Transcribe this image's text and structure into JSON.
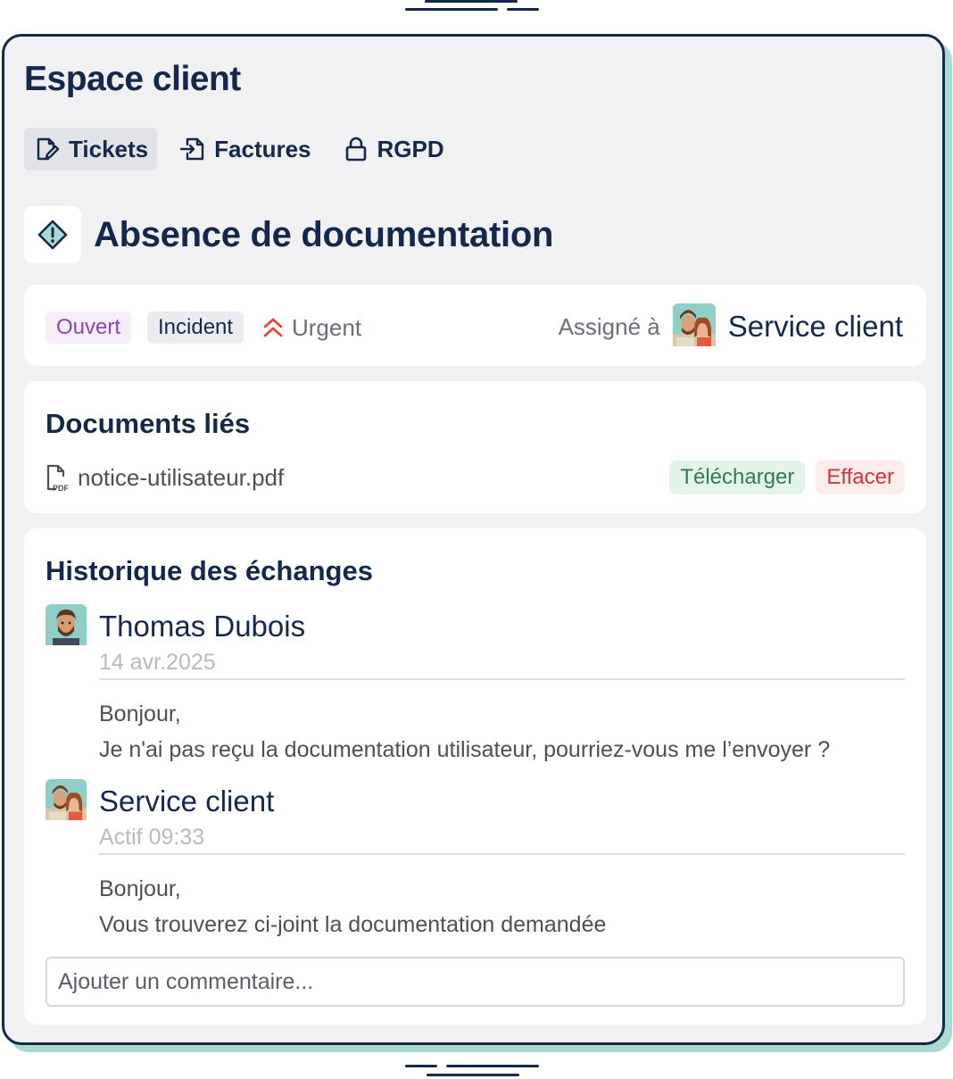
{
  "app": {
    "title": "Espace client"
  },
  "tabs": [
    {
      "label": "Tickets",
      "icon": "edit-document-icon",
      "active": true
    },
    {
      "label": "Factures",
      "icon": "file-import-icon",
      "active": false
    },
    {
      "label": "RGPD",
      "icon": "lock-icon",
      "active": false
    }
  ],
  "ticket": {
    "title": "Absence de documentation",
    "icon": "diamond-warning-icon",
    "status": "Ouvert",
    "type": "Incident",
    "priority": "Urgent",
    "assigned_label": "Assigné à",
    "assignee": "Service client"
  },
  "documents": {
    "heading": "Documents liés",
    "files": [
      {
        "name": "notice-utilisateur.pdf",
        "icon": "pdf-file-icon",
        "download_label": "Télécharger",
        "delete_label": "Effacer"
      }
    ]
  },
  "history": {
    "heading": "Historique des échanges",
    "messages": [
      {
        "author": "Thomas Dubois",
        "date": "14 avr.2025",
        "lines": [
          "Bonjour,",
          "Je n'ai pas reçu la documentation utilisateur, pourriez-vous me l’envoyer ?"
        ]
      },
      {
        "author": "Service client",
        "date": "Actif 09:33",
        "lines": [
          "Bonjour,",
          "Vous trouverez ci-joint la documentation demandée"
        ]
      }
    ],
    "comment_placeholder": "Ajouter un commentaire..."
  },
  "colors": {
    "primary": "#14284b",
    "accent_shadow": "#a9dcd0",
    "urgent": "#e0453f",
    "success": "#2e7d4f",
    "danger": "#c73a3a",
    "open": "#8b44b0"
  }
}
